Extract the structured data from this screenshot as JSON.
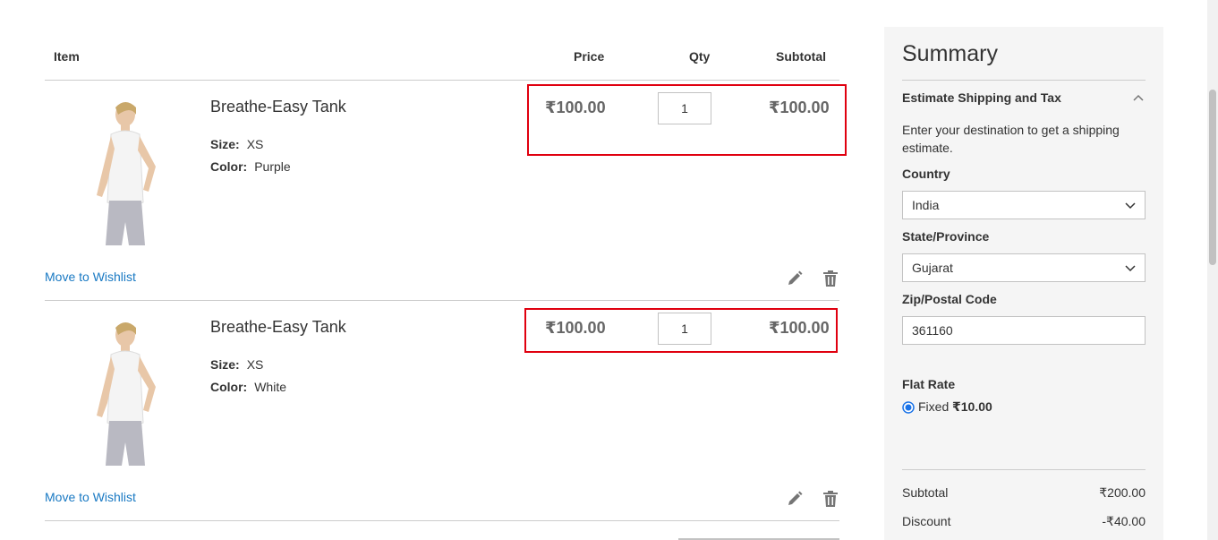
{
  "cart": {
    "headers": {
      "item": "Item",
      "price": "Price",
      "qty": "Qty",
      "subtotal": "Subtotal"
    },
    "items": [
      {
        "name": "Breathe-Easy Tank",
        "size_label": "Size:",
        "size": "XS",
        "color_label": "Color:",
        "color": "Purple",
        "price": "₹100.00",
        "qty": "1",
        "subtotal": "₹100.00",
        "wishlist": "Move to Wishlist"
      },
      {
        "name": "Breathe-Easy Tank",
        "size_label": "Size:",
        "size": "XS",
        "color_label": "Color:",
        "color": "White",
        "price": "₹100.00",
        "qty": "1",
        "subtotal": "₹100.00",
        "wishlist": "Move to Wishlist"
      }
    ]
  },
  "summary": {
    "title": "Summary",
    "estimate_title": "Estimate Shipping and Tax",
    "estimate_text": "Enter your destination to get a shipping estimate.",
    "country_label": "Country",
    "country": "India",
    "state_label": "State/Province",
    "state": "Gujarat",
    "zip_label": "Zip/Postal Code",
    "zip": "361160",
    "flat_rate_label": "Flat Rate",
    "fixed_label": "Fixed",
    "fixed_price": "₹10.00",
    "subtotal_label": "Subtotal",
    "subtotal": "₹200.00",
    "discount_label": "Discount",
    "discount": "-₹40.00"
  },
  "colors": {
    "link": "#1979c3",
    "highlight": "#e0000f",
    "summary_bg": "#f5f5f5",
    "radio": "#1a73e8"
  },
  "icons": [
    "edit-icon",
    "trash-icon",
    "chevron-up-icon",
    "chevron-down-icon"
  ]
}
